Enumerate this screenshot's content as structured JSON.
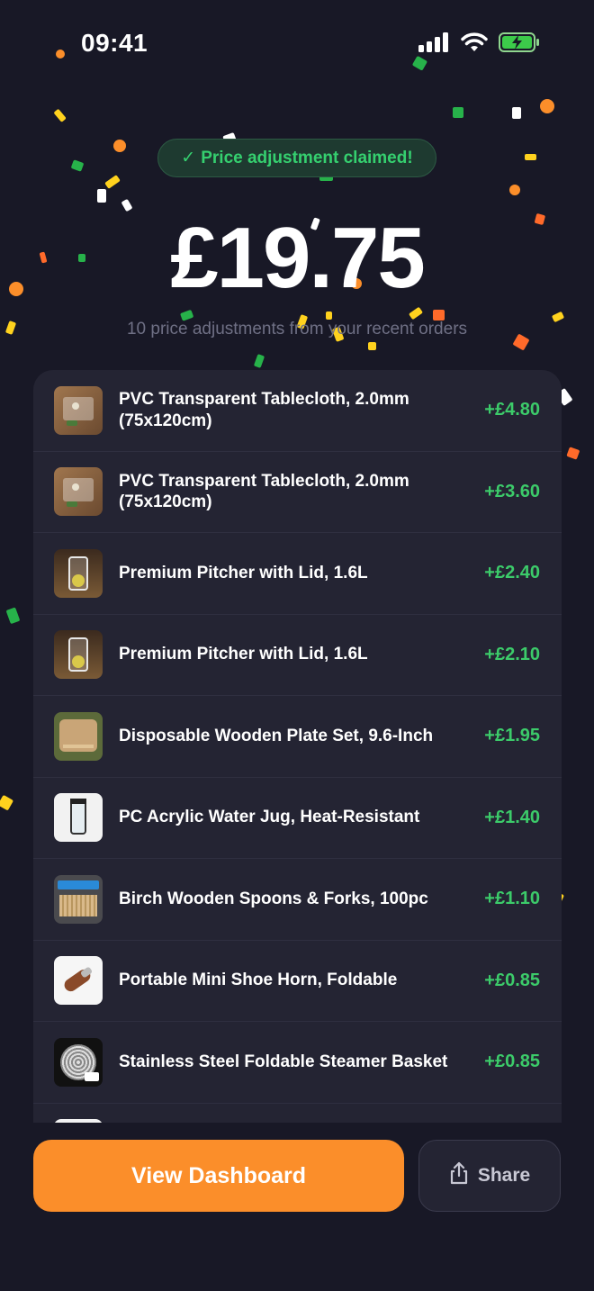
{
  "status": {
    "time": "09:41"
  },
  "badge": {
    "check": "✓",
    "text": "Price adjustment claimed!"
  },
  "summary": {
    "amount": "£19.75",
    "subtitle": "10 price adjustments from your recent orders"
  },
  "items": [
    {
      "name": "PVC Transparent Tablecloth, 2.0mm (75x120cm)",
      "amount": "+£4.80",
      "thumb": "tablecloth"
    },
    {
      "name": "PVC Transparent Tablecloth, 2.0mm (75x120cm)",
      "amount": "+£3.60",
      "thumb": "tablecloth"
    },
    {
      "name": "Premium Pitcher with Lid, 1.6L",
      "amount": "+£2.40",
      "thumb": "pitcher"
    },
    {
      "name": "Premium Pitcher with Lid, 1.6L",
      "amount": "+£2.10",
      "thumb": "pitcher"
    },
    {
      "name": "Disposable Wooden Plate Set, 9.6-Inch",
      "amount": "+£1.95",
      "thumb": "plates"
    },
    {
      "name": "PC Acrylic Water Jug, Heat-Resistant",
      "amount": "+£1.40",
      "thumb": "jug"
    },
    {
      "name": "Birch Wooden Spoons & Forks, 100pc",
      "amount": "+£1.10",
      "thumb": "spoons"
    },
    {
      "name": "Portable Mini Shoe Horn, Foldable",
      "amount": "+£0.85",
      "thumb": "shoehorn"
    },
    {
      "name": "Stainless Steel Foldable Steamer Basket",
      "amount": "+£0.85",
      "thumb": "steamer"
    }
  ],
  "actions": {
    "primary": "View Dashboard",
    "share": "Share"
  },
  "colors": {
    "background": "#181826",
    "card": "#242433",
    "accent": "#fb8e2a",
    "positive": "#3ccb6a",
    "badge_text": "#35d06f"
  },
  "icons": [
    "signal-icon",
    "wifi-icon",
    "battery-charging-icon",
    "check-icon",
    "share-icon"
  ]
}
